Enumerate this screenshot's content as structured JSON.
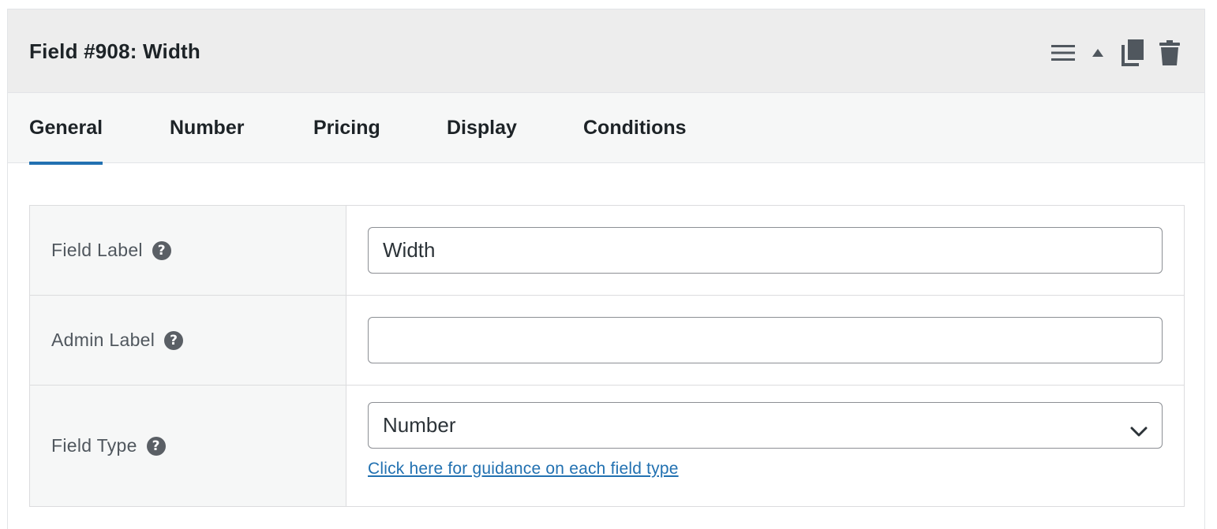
{
  "header": {
    "title": "Field #908: Width",
    "actions": [
      {
        "name": "menu-icon"
      },
      {
        "name": "collapse-arrow-icon"
      },
      {
        "name": "duplicate-icon"
      },
      {
        "name": "trash-icon"
      }
    ]
  },
  "tabs": [
    {
      "label": "General",
      "active": true
    },
    {
      "label": "Number",
      "active": false
    },
    {
      "label": "Pricing",
      "active": false
    },
    {
      "label": "Display",
      "active": false
    },
    {
      "label": "Conditions",
      "active": false
    }
  ],
  "form": {
    "field_label": {
      "label": "Field Label",
      "help": "?",
      "value": "Width"
    },
    "admin_label": {
      "label": "Admin Label",
      "help": "?",
      "value": ""
    },
    "field_type": {
      "label": "Field Type",
      "help": "?",
      "selected": "Number",
      "link_text": "Click here for guidance on each field type"
    }
  },
  "colors": {
    "accent": "#2271b1",
    "header_bg": "#ededed",
    "tabs_bg": "#f6f7f7"
  }
}
